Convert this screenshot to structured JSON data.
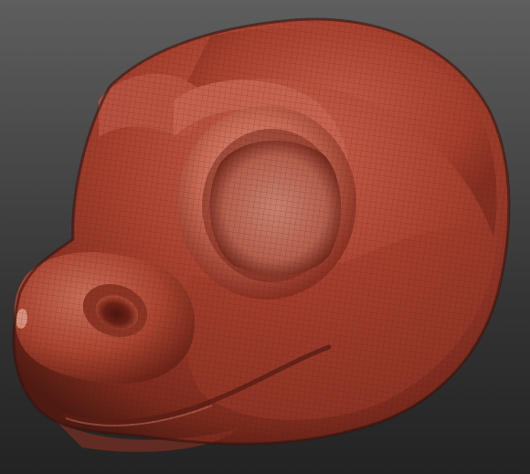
{
  "scene": {
    "subject": "sculpted-creature-head",
    "colors": {
      "background_top": "#5e5e5e",
      "background_bottom": "#232323",
      "material_base": "#a13c2c",
      "material_highlight": "#d9826d",
      "material_shadow": "#5a1d14",
      "wireframe": "#4a160f"
    }
  }
}
